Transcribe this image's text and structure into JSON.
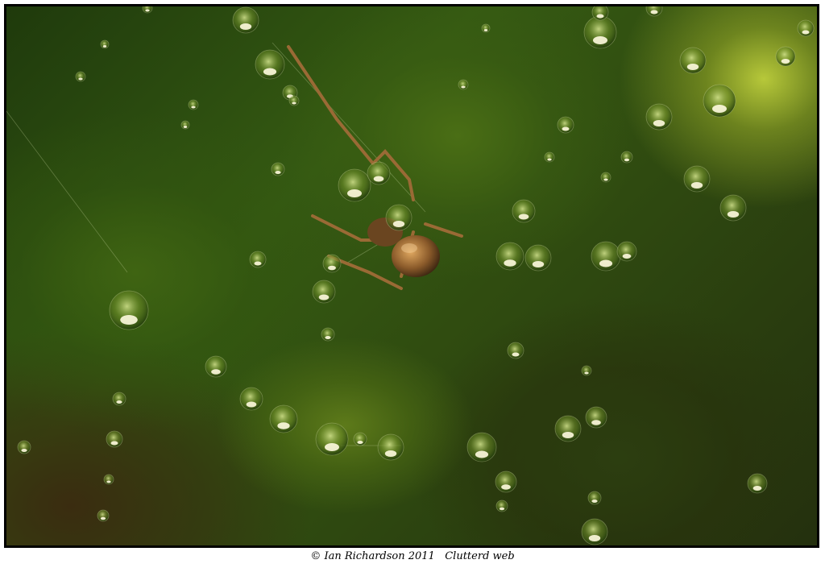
{
  "caption": {
    "copyright": "© Ian Richardson 2011",
    "title": "Clutterd web"
  },
  "colors": {
    "border": "#000000",
    "mat": "#ffffff",
    "background_green": "#355a12",
    "highlight_yellow_green": "#b7c83a",
    "spider_brown": "#8a5a2a"
  }
}
